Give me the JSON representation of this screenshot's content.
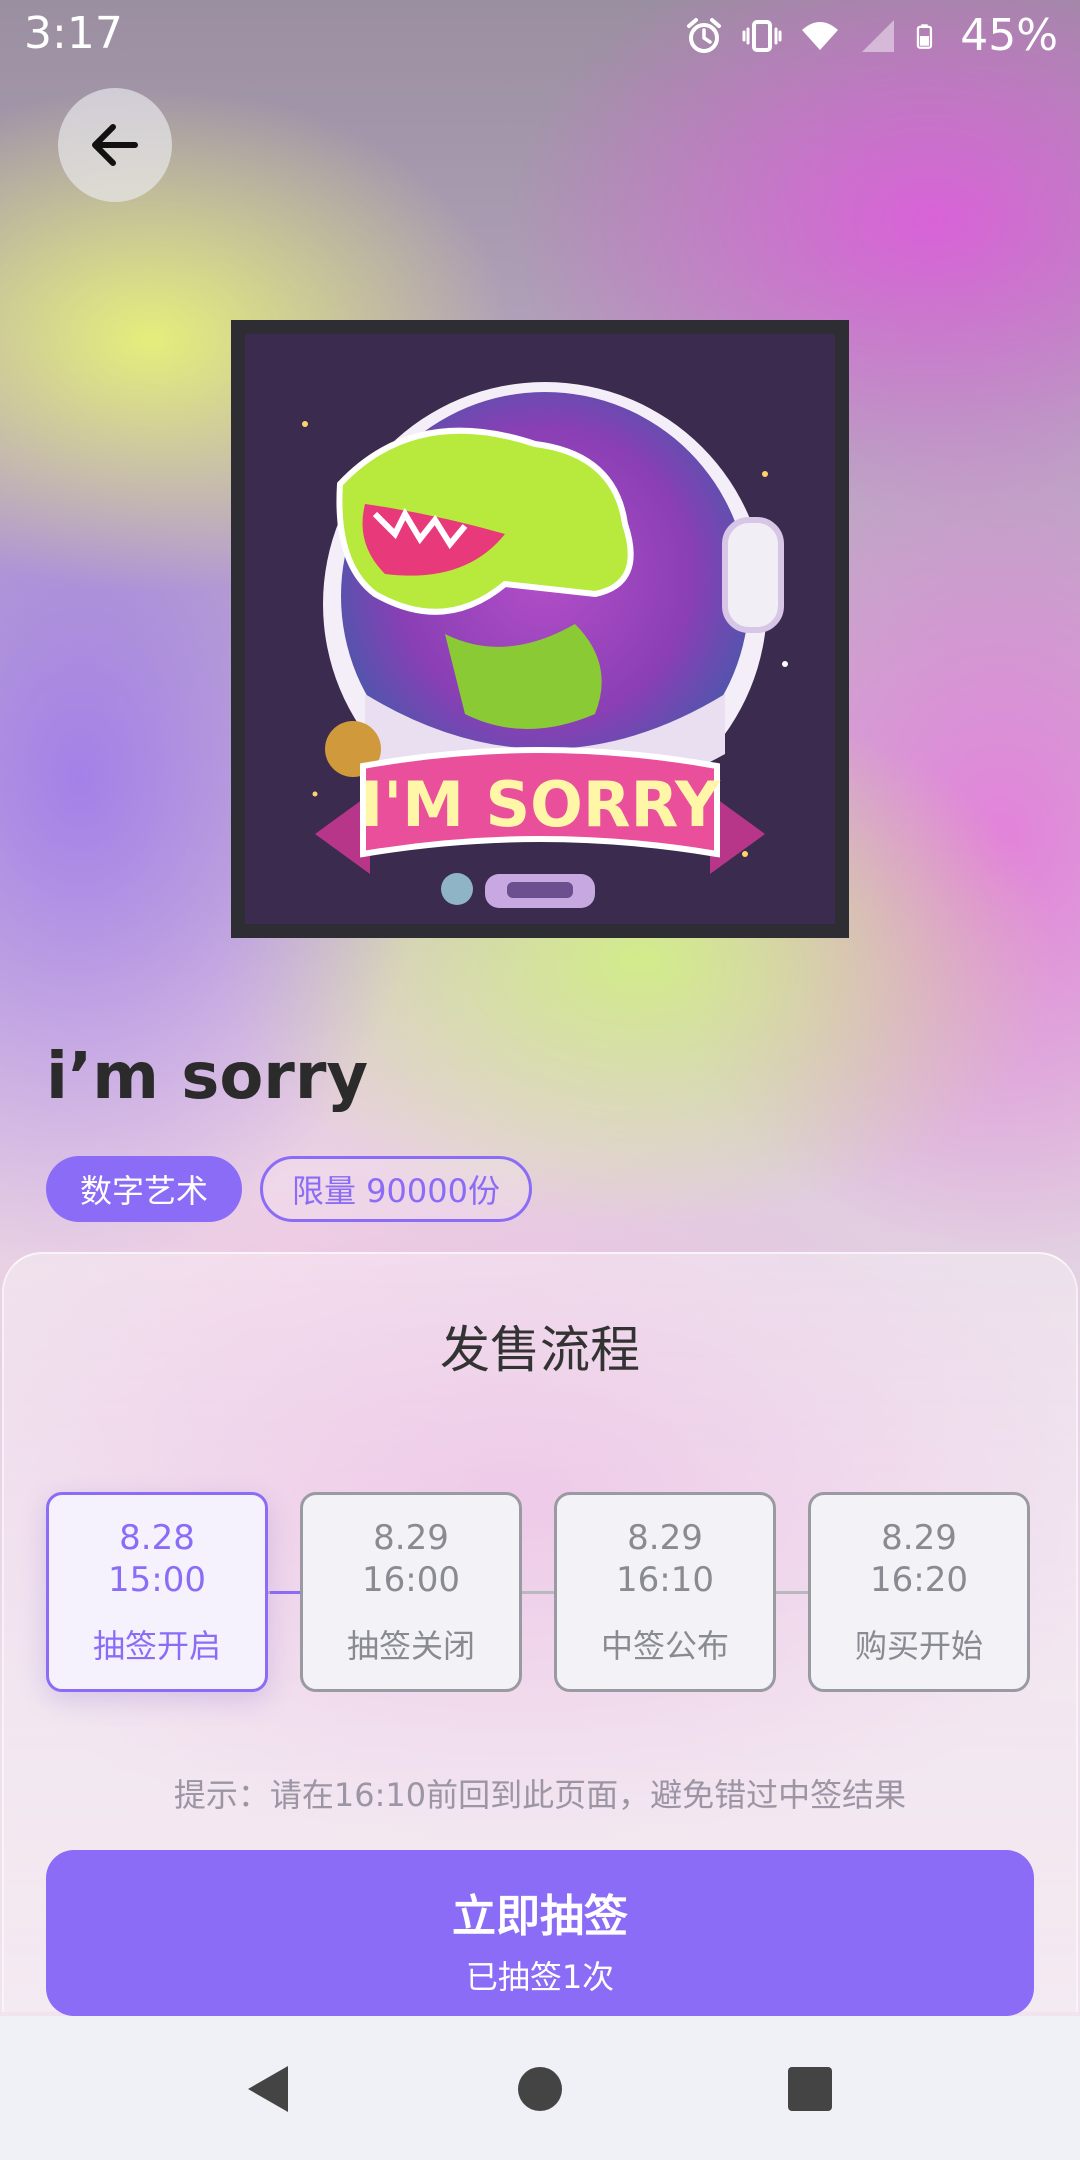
{
  "status_bar": {
    "time": "3:17",
    "battery_percent": "45%",
    "icons": [
      "alarm-icon",
      "vibrate-icon",
      "wifi-icon",
      "signal-icon",
      "battery-icon"
    ]
  },
  "header": {
    "back_icon": "arrow-left-icon"
  },
  "artwork": {
    "banner_text": "I'M SORRY"
  },
  "product": {
    "title": "i’m sorry",
    "tags": [
      "数字艺术",
      "限量 90000份"
    ]
  },
  "sale_process": {
    "title": "发售流程",
    "steps": [
      {
        "date": "8.28",
        "time": "15:00",
        "label": "抽签开启",
        "active": true
      },
      {
        "date": "8.29",
        "time": "16:00",
        "label": "抽签关闭",
        "active": false
      },
      {
        "date": "8.29",
        "time": "16:10",
        "label": "中签公布",
        "active": false
      },
      {
        "date": "8.29",
        "time": "16:20",
        "label": "购买开始",
        "active": false
      }
    ],
    "hint": "提示：请在16:10前回到此页面，避免错过中签结果"
  },
  "cta": {
    "label": "立即抽签",
    "sublabel": "已抽签1次"
  },
  "colors": {
    "accent": "#8b6cf6",
    "muted_border": "#9a9aa2"
  },
  "nav": [
    "back-triangle-icon",
    "home-circle-icon",
    "recents-square-icon"
  ]
}
